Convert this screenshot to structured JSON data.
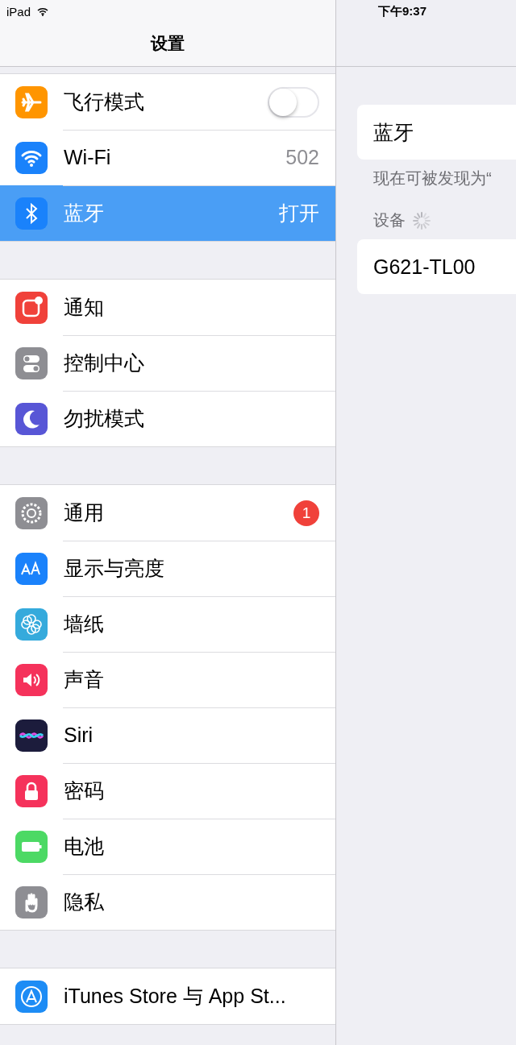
{
  "status_bar": {
    "device": "iPad",
    "time": "下午9:37"
  },
  "sidebar": {
    "title": "设置",
    "groups": [
      {
        "items": [
          {
            "label": "飞行模式",
            "kind": "toggle",
            "on": false,
            "selected": false
          },
          {
            "label": "Wi-Fi",
            "kind": "value",
            "value": "502",
            "selected": false
          },
          {
            "label": "蓝牙",
            "kind": "value",
            "value": "打开",
            "selected": true
          }
        ]
      },
      {
        "items": [
          {
            "label": "通知",
            "kind": "plain",
            "selected": false
          },
          {
            "label": "控制中心",
            "kind": "plain",
            "selected": false
          },
          {
            "label": "勿扰模式",
            "kind": "plain",
            "selected": false
          }
        ]
      },
      {
        "items": [
          {
            "label": "通用",
            "kind": "badge",
            "badge": "1",
            "selected": false
          },
          {
            "label": "显示与亮度",
            "kind": "plain",
            "selected": false
          },
          {
            "label": "墙纸",
            "kind": "plain",
            "selected": false
          },
          {
            "label": "声音",
            "kind": "plain",
            "selected": false
          },
          {
            "label": "Siri",
            "kind": "plain",
            "selected": false
          },
          {
            "label": "密码",
            "kind": "plain",
            "selected": false
          },
          {
            "label": "电池",
            "kind": "plain",
            "selected": false
          },
          {
            "label": "隐私",
            "kind": "plain",
            "selected": false
          }
        ]
      },
      {
        "items": [
          {
            "label": "iTunes Store 与 App St...",
            "kind": "plain",
            "selected": false
          }
        ]
      }
    ]
  },
  "detail": {
    "title_cell": "蓝牙",
    "footer": "现在可被发现为“",
    "devices_header": "设备",
    "devices_loading": true,
    "devices": [
      "G621-TL00"
    ]
  }
}
